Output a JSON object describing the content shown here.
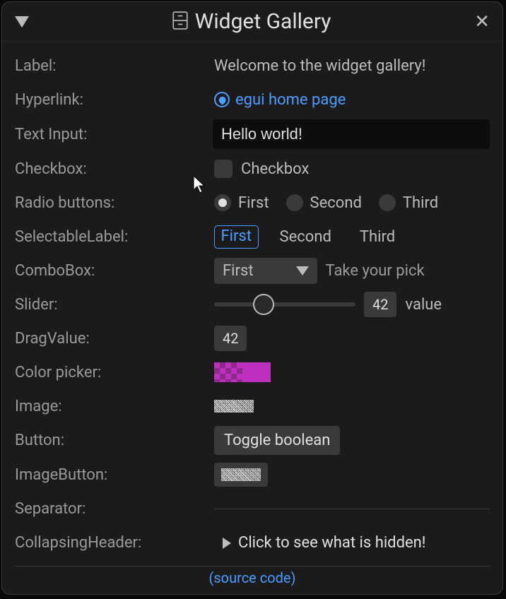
{
  "window": {
    "title": "Widget Gallery"
  },
  "rows": {
    "label": {
      "name": "Label:",
      "value": "Welcome to the widget gallery!"
    },
    "hyperlink": {
      "name": "Hyperlink:",
      "text": "egui home page"
    },
    "text_input": {
      "name": "Text Input:",
      "value": "Hello world!"
    },
    "checkbox": {
      "name": "Checkbox:",
      "label": "Checkbox",
      "checked": false
    },
    "radio": {
      "name": "Radio buttons:",
      "options": [
        "First",
        "Second",
        "Third"
      ],
      "selected": "First"
    },
    "selectable": {
      "name": "SelectableLabel:",
      "options": [
        "First",
        "Second",
        "Third"
      ],
      "selected": "First"
    },
    "combo": {
      "name": "ComboBox:",
      "value": "First",
      "hint": "Take your pick"
    },
    "slider": {
      "name": "Slider:",
      "value": 42,
      "label": "value"
    },
    "drag": {
      "name": "DragValue:",
      "value": 42
    },
    "color": {
      "name": "Color picker:",
      "hex": "#c030c0"
    },
    "image": {
      "name": "Image:"
    },
    "button": {
      "name": "Button:",
      "label": "Toggle boolean"
    },
    "image_button": {
      "name": "ImageButton:"
    },
    "separator": {
      "name": "Separator:"
    },
    "collapsing": {
      "name": "CollapsingHeader:",
      "label": "Click to see what is hidden!"
    }
  },
  "footer": {
    "source": "(source code)"
  }
}
